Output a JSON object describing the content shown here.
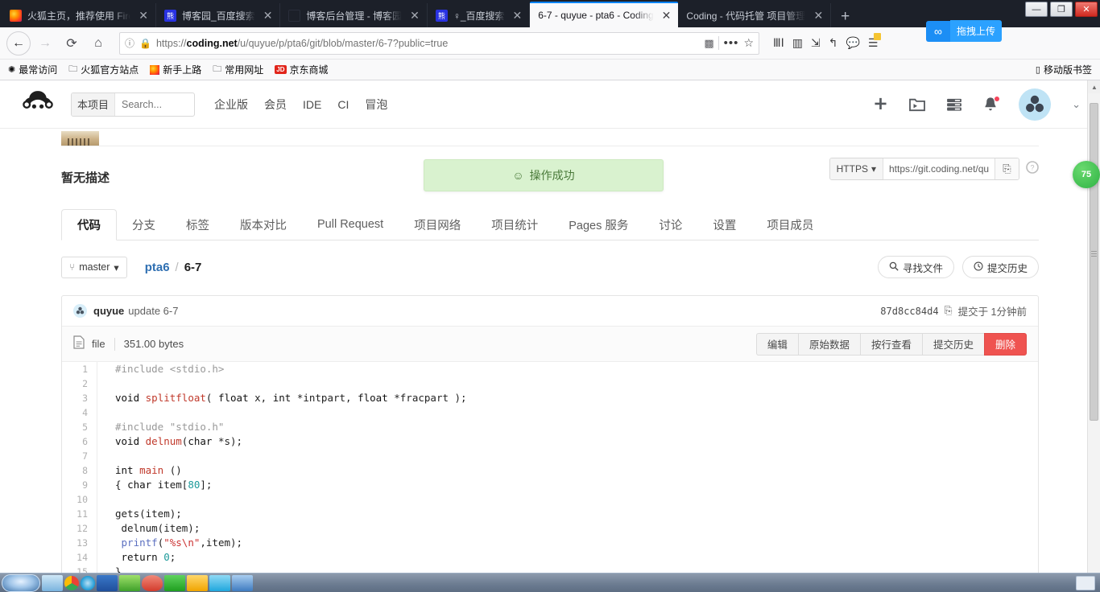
{
  "browser": {
    "tabs": [
      {
        "title": "火狐主页，推荐使用 Firefox",
        "favicon": "firefox-icon",
        "active": false,
        "close": "✕"
      },
      {
        "title": "博客园_百度搜索",
        "favicon": "baidu-icon",
        "active": false,
        "close": "✕"
      },
      {
        "title": "博客后台管理 - 博客园",
        "favicon": "blank-icon",
        "active": false,
        "close": "✕"
      },
      {
        "title": "♀_百度搜索",
        "favicon": "baidu-icon",
        "active": false,
        "close": "✕"
      },
      {
        "title": "6-7 - quyue - pta6 - Coding",
        "favicon": "coding-icon",
        "active": true,
        "close": "✕"
      },
      {
        "title": "Coding - 代码托管 项目管理",
        "favicon": "coding-icon",
        "active": false,
        "close": "✕"
      }
    ],
    "new_tab_label": "+",
    "window_controls": {
      "minimize": "—",
      "maximize": "❐",
      "close": "✕"
    },
    "nav": {
      "back": "←",
      "forward": "→",
      "reload": "⟳",
      "home": "⌂",
      "info_icon": "ⓘ",
      "lock_icon": "🔒",
      "url_scheme": "https://",
      "url_domain": "coding.net",
      "url_path": "/u/quyue/p/pta6/git/blob/master/6-7?public=true",
      "qr_icon": "▩",
      "more_icon": "•••",
      "bookmark_star": "☆",
      "right_icons": [
        "library-icon",
        "sidebar-icon",
        "save-page-icon",
        "undo-icon",
        "chat-icon",
        "menu-icon"
      ]
    },
    "upload_popup": {
      "icon": "∞",
      "label": "拖拽上传"
    },
    "bookmarks": [
      {
        "label": "最常访问",
        "icon": "gear-icon"
      },
      {
        "label": "火狐官方站点",
        "icon": "folder-icon"
      },
      {
        "label": "新手上路",
        "icon": "firefox-icon"
      },
      {
        "label": "常用网址",
        "icon": "folder-icon"
      },
      {
        "label": "京东商城",
        "icon": "jd-icon"
      }
    ],
    "bookmarks_right": {
      "label": "移动版书签",
      "icon": "mobile-icon"
    }
  },
  "site": {
    "logo_name": "coding-monkey-logo",
    "search": {
      "scope": "本项目",
      "placeholder": "Search...",
      "value": ""
    },
    "topnav": [
      "企业版",
      "会员",
      "IDE",
      "CI",
      "冒泡"
    ],
    "toast": {
      "icon": "☺",
      "message": "操作成功"
    },
    "header_icons": [
      {
        "name": "add-icon",
        "glyph": "✚"
      },
      {
        "name": "projects-icon",
        "glyph": "🗂"
      },
      {
        "name": "tasks-icon",
        "glyph": "☰"
      },
      {
        "name": "notifications-icon",
        "glyph": "🔔",
        "badge": true
      }
    ],
    "avatar_name": "user-avatar",
    "caret": "⌄"
  },
  "project": {
    "description": "暂无描述",
    "clone": {
      "protocol": "HTTPS",
      "protocol_caret": "▾",
      "url": "https://git.coding.net/qu",
      "copy_icon": "⎘",
      "help_icon": "?"
    },
    "tabs": [
      {
        "label": "代码",
        "active": true
      },
      {
        "label": "分支",
        "active": false
      },
      {
        "label": "标签",
        "active": false
      },
      {
        "label": "版本对比",
        "active": false
      },
      {
        "label": "Pull Request",
        "active": false
      },
      {
        "label": "项目网络",
        "active": false
      },
      {
        "label": "项目统计",
        "active": false
      },
      {
        "label": "Pages 服务",
        "active": false
      },
      {
        "label": "讨论",
        "active": false
      },
      {
        "label": "设置",
        "active": false
      },
      {
        "label": "项目成员",
        "active": false
      }
    ],
    "branch": {
      "icon": "branch-icon",
      "name": "master",
      "caret": "▾"
    },
    "breadcrumb": {
      "repo": "pta6",
      "sep": "/",
      "current": "6-7"
    },
    "actions": [
      {
        "label": "寻找文件",
        "icon": "search-icon"
      },
      {
        "label": "提交历史",
        "icon": "clock-icon"
      }
    ]
  },
  "commit": {
    "author": "quyue",
    "message": "update 6-7",
    "hash": "87d8cc84d4",
    "copy_icon": "⎘",
    "time": "提交于 1分钟前"
  },
  "file": {
    "icon": "file-icon",
    "name": "file",
    "size": "351.00 bytes",
    "buttons": [
      {
        "label": "编辑",
        "danger": false
      },
      {
        "label": "原始数据",
        "danger": false
      },
      {
        "label": "按行查看",
        "danger": false
      },
      {
        "label": "提交历史",
        "danger": false
      },
      {
        "label": "删除",
        "danger": true
      }
    ]
  },
  "code": {
    "language": "c",
    "lines": [
      {
        "n": 1,
        "tokens": [
          {
            "t": "#include <stdio.h>",
            "c": "pp"
          }
        ]
      },
      {
        "n": 2,
        "tokens": []
      },
      {
        "n": 3,
        "tokens": [
          {
            "t": "void ",
            "c": "k"
          },
          {
            "t": "splitfloat",
            "c": "fn"
          },
          {
            "t": "( ",
            "c": ""
          },
          {
            "t": "float",
            "c": "k"
          },
          {
            "t": " x, ",
            "c": ""
          },
          {
            "t": "int",
            "c": "k"
          },
          {
            "t": " *intpart, ",
            "c": ""
          },
          {
            "t": "float",
            "c": "k"
          },
          {
            "t": " *fracpart );",
            "c": ""
          }
        ]
      },
      {
        "n": 4,
        "tokens": []
      },
      {
        "n": 5,
        "tokens": [
          {
            "t": "#include \"stdio.h\"",
            "c": "pp"
          }
        ]
      },
      {
        "n": 6,
        "tokens": [
          {
            "t": "void ",
            "c": "k"
          },
          {
            "t": "delnum",
            "c": "fn"
          },
          {
            "t": "(",
            "c": ""
          },
          {
            "t": "char",
            "c": "k"
          },
          {
            "t": " *s);",
            "c": ""
          }
        ]
      },
      {
        "n": 7,
        "tokens": []
      },
      {
        "n": 8,
        "tokens": [
          {
            "t": "int ",
            "c": "k"
          },
          {
            "t": "main",
            "c": "fn"
          },
          {
            "t": " ()",
            "c": ""
          }
        ]
      },
      {
        "n": 9,
        "tokens": [
          {
            "t": "{ ",
            "c": ""
          },
          {
            "t": "char",
            "c": "k"
          },
          {
            "t": " item[",
            "c": ""
          },
          {
            "t": "80",
            "c": "num"
          },
          {
            "t": "];",
            "c": ""
          }
        ]
      },
      {
        "n": 10,
        "tokens": []
      },
      {
        "n": 11,
        "tokens": [
          {
            "t": "gets(item);",
            "c": ""
          }
        ]
      },
      {
        "n": 12,
        "tokens": [
          {
            "t": " delnum(item);",
            "c": ""
          }
        ]
      },
      {
        "n": 13,
        "tokens": [
          {
            "t": " ",
            "c": ""
          },
          {
            "t": "printf",
            "c": "call"
          },
          {
            "t": "(",
            "c": ""
          },
          {
            "t": "\"%s\\n\"",
            "c": "str"
          },
          {
            "t": ",item);",
            "c": ""
          }
        ]
      },
      {
        "n": 14,
        "tokens": [
          {
            "t": " ",
            "c": ""
          },
          {
            "t": "return ",
            "c": "k"
          },
          {
            "t": "0",
            "c": "num"
          },
          {
            "t": ";",
            "c": ""
          }
        ]
      },
      {
        "n": 15,
        "tokens": [
          {
            "t": "}",
            "c": ""
          }
        ]
      }
    ]
  },
  "float_widget": {
    "label": "75",
    "color": "#2fb344"
  },
  "taskbar": {
    "start_label": "start",
    "items": [
      "explorer-icon",
      "chrome-icon",
      "ie-icon",
      "word-icon",
      "app-green-icon",
      "app-red-icon",
      "app-green2-icon",
      "app-yellow-icon",
      "app-cyan-icon",
      "app-blue-icon"
    ]
  }
}
